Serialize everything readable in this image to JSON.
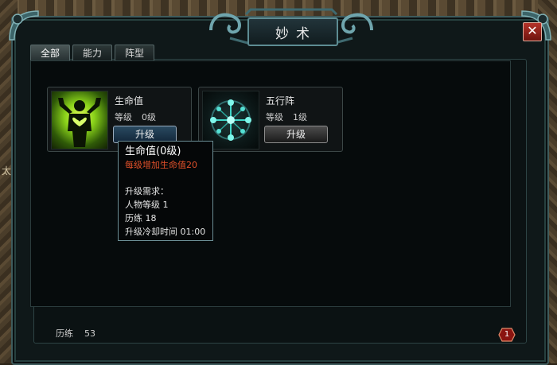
{
  "background": {
    "edge_text": "太"
  },
  "window": {
    "title": "妙术",
    "close_label": "✕"
  },
  "tabs": [
    {
      "label": "全部",
      "active": true
    },
    {
      "label": "能力",
      "active": false
    },
    {
      "label": "阵型",
      "active": false
    }
  ],
  "skills": [
    {
      "name": "生命值",
      "level_label": "等级",
      "level_value": "0级",
      "upgrade_label": "升级",
      "icon": "life-figure-icon"
    },
    {
      "name": "五行阵",
      "level_label": "等级",
      "level_value": "1级",
      "upgrade_label": "升级",
      "icon": "five-elements-formation-icon"
    }
  ],
  "tooltip": {
    "title": "生命值(0级)",
    "effect": "每级增加生命值20",
    "requirements_header": "升级需求：",
    "req_character_level": "人物等级 1",
    "req_experience": "历练 18",
    "req_cooldown": "升级冷却时间 01:00"
  },
  "footer": {
    "experience_label": "历练",
    "experience_value": "53",
    "page_badge": "1"
  },
  "colors": {
    "accent_frame": "#3e5b5c",
    "effect_text": "#e0502a",
    "close_red": "#b43329"
  }
}
